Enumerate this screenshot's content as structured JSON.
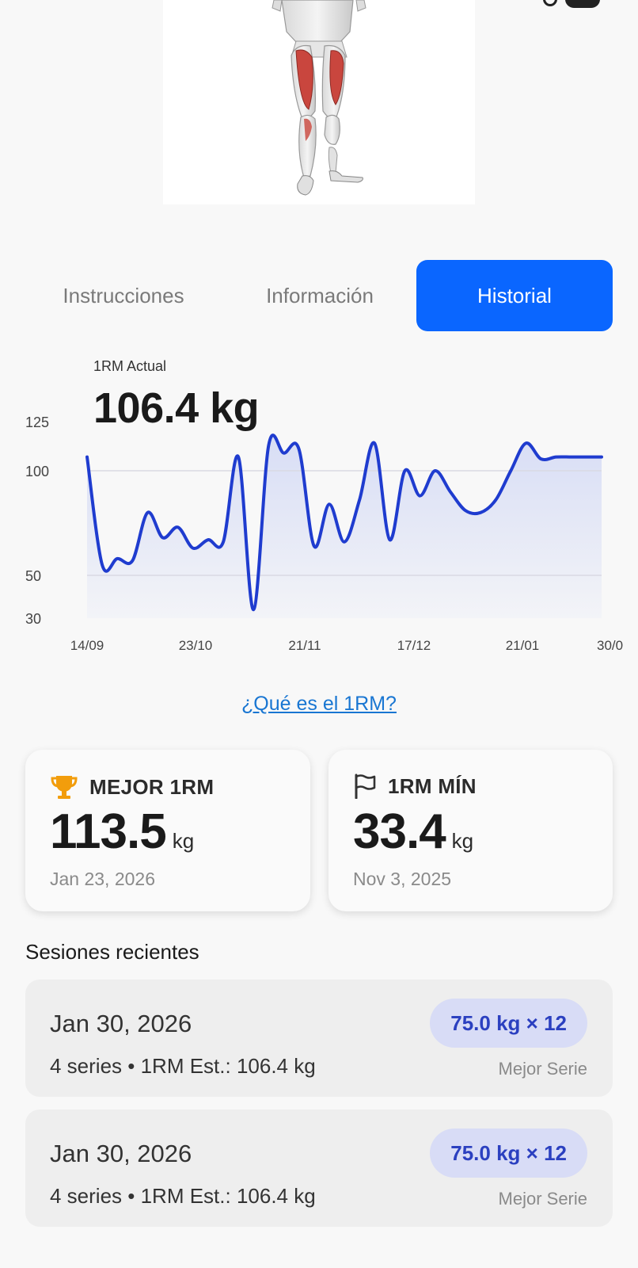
{
  "tabs": [
    "Instrucciones",
    "Información",
    "Historial"
  ],
  "current_1rm": {
    "label": "1RM Actual",
    "value": "106.4 kg"
  },
  "chart_data": {
    "type": "area",
    "y_ticks": [
      "125",
      "100",
      "50",
      "30"
    ],
    "x_ticks": [
      "14/09",
      "23/10",
      "21/11",
      "17/12",
      "21/01",
      "30/0"
    ],
    "ylim": [
      30,
      125
    ],
    "grid": true,
    "line_color": "#1f3ccf",
    "fill_color": "#d6dcf5",
    "x": [
      0,
      1,
      2,
      3,
      4,
      5,
      6,
      7,
      8,
      9,
      10,
      11,
      12,
      13,
      14,
      15,
      16,
      17,
      18,
      19,
      20,
      21,
      22,
      23,
      24,
      25,
      26,
      27,
      28,
      29,
      30,
      31,
      32,
      33,
      34
    ],
    "values": [
      107,
      55,
      58,
      57,
      80,
      68,
      73,
      63,
      67,
      66,
      107,
      34,
      113,
      109,
      111,
      64,
      84,
      66,
      86,
      114,
      67,
      100,
      88,
      100,
      90,
      81,
      80,
      86,
      100,
      114,
      106,
      107,
      107,
      107,
      107
    ]
  },
  "link_1rm": "¿Qué es el 1RM?",
  "best": {
    "label": "MEJOR 1RM",
    "value": "113.5",
    "unit": "kg",
    "date": "Jan 23, 2026"
  },
  "min": {
    "label": "1RM MÍN",
    "value": "33.4",
    "unit": "kg",
    "date": "Nov 3, 2025"
  },
  "sessions_title": "Sesiones recientes",
  "sessions": [
    {
      "date": "Jan 30, 2026",
      "info": "4 series • 1RM Est.: 106.4 kg",
      "best_set": "75.0 kg × 12",
      "best_label": "Mejor Serie"
    },
    {
      "date": "Jan 30, 2026",
      "info": "4 series • 1RM Est.: 106.4 kg",
      "best_set": "75.0 kg × 12",
      "best_label": "Mejor Serie"
    }
  ],
  "colors": {
    "accent": "#0a66ff",
    "link": "#1976d2",
    "badge_bg": "#d8dcf6",
    "badge_text": "#2b40c0",
    "trophy": "#f29d0c"
  }
}
